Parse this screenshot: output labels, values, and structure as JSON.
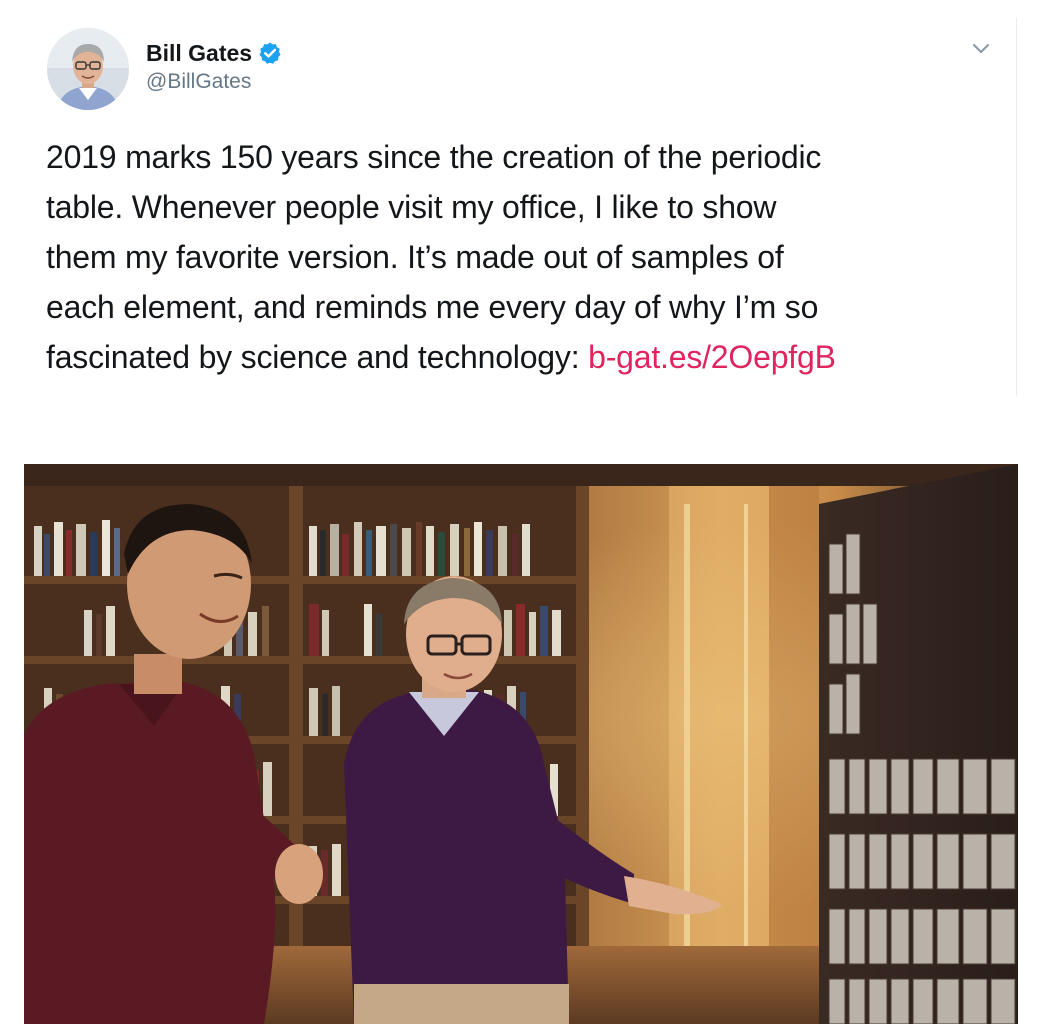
{
  "tweet": {
    "author": {
      "display_name": "Bill Gates",
      "handle": "@BillGates",
      "verified": true,
      "avatar_icon": "profile-photo"
    },
    "text_lines": [
      "2019 marks 150 years since the creation of the periodic",
      "table. Whenever people visit my office, I like to show",
      "them my favorite version. It’s made out of samples of",
      "each element, and reminds me every day of why I’m so",
      "fascinated by science and technology: "
    ],
    "link_text": "b-gat.es/2OepfgB",
    "menu_icon": "chevron-down-icon"
  },
  "colors": {
    "link": "#e0245e",
    "verified": "#1da1f2",
    "handle": "#657786",
    "text": "#14171a"
  }
}
